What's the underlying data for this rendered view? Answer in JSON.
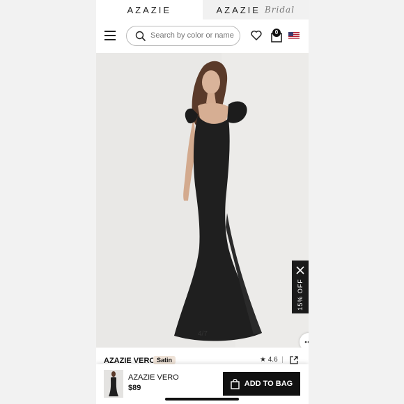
{
  "brands": {
    "main": "AZAZIE",
    "secondary": "AZAZIE",
    "secondary_script": "Bridal"
  },
  "header": {
    "menu_icon": "hamburger-icon",
    "search_placeholder": "Search by color or name",
    "wishlist_icon": "heart-icon",
    "cart_icon": "shopping-bag-icon",
    "cart_count": "0",
    "region_icon": "us-flag-icon"
  },
  "gallery": {
    "counter": "4/7"
  },
  "promo": {
    "text": "15% OFF",
    "close_icon": "close-icon"
  },
  "product": {
    "name": "AZAZIE VERO",
    "fabric": "Satin",
    "rating": "4.6",
    "rating_icon": "star-icon",
    "share_icon": "share-icon"
  },
  "bottom_bar": {
    "name": "AZAZIE VERO",
    "price": "$89",
    "button_label": "ADD TO BAG",
    "button_icon": "shopping-bag-icon"
  },
  "colors": {
    "accent": "#111111",
    "fabric_tag": "#efe3d8",
    "background": "#e9e8e6"
  }
}
